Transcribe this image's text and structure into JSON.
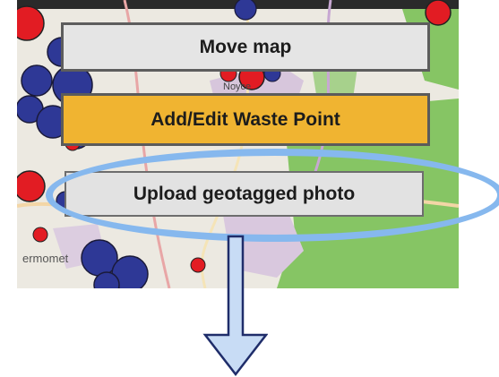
{
  "map": {
    "place_label_left": "ermomet",
    "place_label_top": "Noyce"
  },
  "buttons": {
    "move_map": "Move map",
    "add_edit_waste_point": "Add/Edit Waste Point",
    "upload_geotagged_photo": "Upload geotagged photo"
  },
  "colors": {
    "waste_point_blue": "#2e3896",
    "waste_point_red": "#e21c23",
    "add_button_orange": "#f0b431",
    "highlight_blue": "#86b8ee",
    "forest_green": "#7fbf5f"
  },
  "annotations": {
    "highlight": "ellipse-outline",
    "arrow": "down-arrow-icon"
  }
}
